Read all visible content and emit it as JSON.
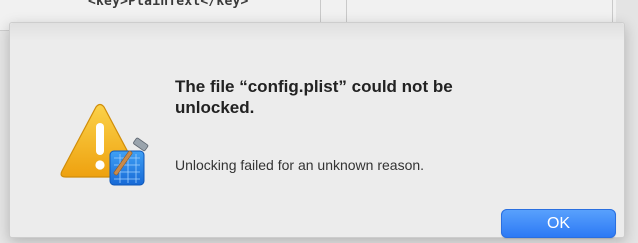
{
  "background": {
    "code_line": "<key>PlainText</key>"
  },
  "alert": {
    "title": "The file “config.plist” could not be unlocked.",
    "message": "Unlocking failed for an unknown reason.",
    "ok_label": "OK",
    "icon": "warning-triangle-with-xcode-badge-icon"
  },
  "colors": {
    "accent": "#2b78f4",
    "warning": "#f2b21f"
  }
}
